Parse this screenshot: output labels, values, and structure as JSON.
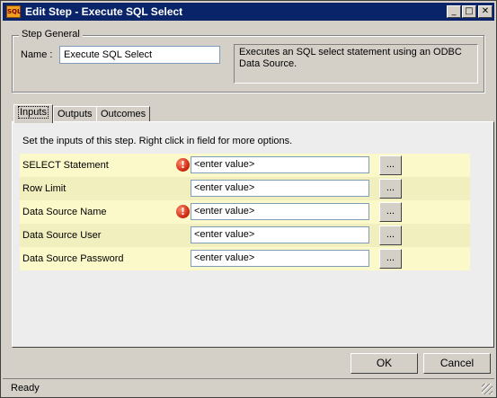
{
  "window": {
    "title": "Edit Step - Execute SQL Select",
    "icon": "app-icon",
    "icon_text": "SQL",
    "minimize_glyph": "_",
    "maximize_glyph": "□",
    "close_glyph": "✕"
  },
  "general": {
    "group_label": "Step General",
    "name_label": "Name :",
    "name_value": "Execute SQL Select",
    "description": "Executes an SQL select statement using an ODBC Data Source."
  },
  "tabs": [
    {
      "label": "Inputs",
      "active": true
    },
    {
      "label": "Outputs",
      "active": false
    },
    {
      "label": "Outcomes",
      "active": false
    }
  ],
  "inputs": {
    "instructions": "Set the inputs of this step.  Right click in field for more options.",
    "browse_label": "...",
    "warning_glyph": "!",
    "rows": [
      {
        "label": "SELECT Statement",
        "value": "<enter value>",
        "required_warning": true
      },
      {
        "label": "Row Limit",
        "value": "<enter value>",
        "required_warning": false
      },
      {
        "label": "Data Source Name",
        "value": "<enter value>",
        "required_warning": true
      },
      {
        "label": "Data Source User",
        "value": "<enter value>",
        "required_warning": false
      },
      {
        "label": "Data Source Password",
        "value": "<enter value>",
        "required_warning": false
      }
    ]
  },
  "buttons": {
    "ok": "OK",
    "cancel": "Cancel"
  },
  "status": {
    "text": "Ready"
  },
  "colors": {
    "titlebar": "#0a246a",
    "row_light": "#fbf8c9",
    "row_dark": "#f1efbd",
    "warning": "#c8200a"
  }
}
